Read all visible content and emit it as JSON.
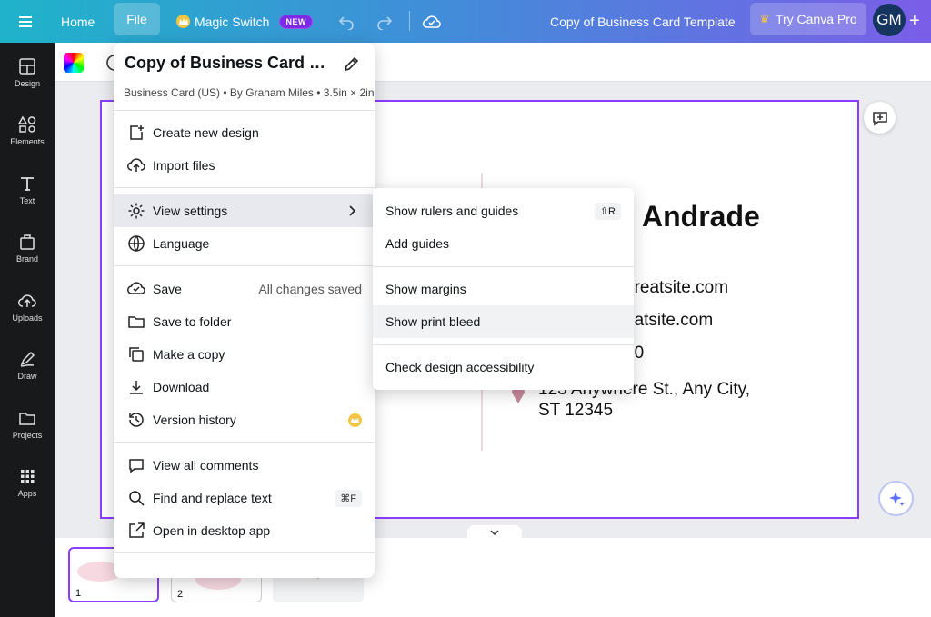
{
  "topbar": {
    "home": "Home",
    "file": "File",
    "magic_switch": "Magic Switch",
    "new_badge": "NEW",
    "doc_title": "Copy of Business Card Template",
    "try_pro": "Try Canva Pro",
    "avatar_initials": "GM",
    "plus": "+"
  },
  "sidebar": {
    "items": [
      {
        "label": "Design",
        "icon": "design-icon"
      },
      {
        "label": "Elements",
        "icon": "elements-icon"
      },
      {
        "label": "Text",
        "icon": "text-icon"
      },
      {
        "label": "Brand",
        "icon": "brand-icon"
      },
      {
        "label": "Uploads",
        "icon": "uploads-icon"
      },
      {
        "label": "Draw",
        "icon": "draw-icon"
      },
      {
        "label": "Projects",
        "icon": "projects-icon"
      },
      {
        "label": "Apps",
        "icon": "apps-icon"
      }
    ]
  },
  "canvas": {
    "name_fragment": "Andrade",
    "email_fragment": "greatsite.com",
    "web_fragment": "eatsite.com",
    "phone_fragment": "90",
    "address": "123 Anywhere St., Any City, ST 12345"
  },
  "file_menu": {
    "title": "Copy of Business Card Temp...",
    "subtitle": "Business Card (US) • By Graham Miles • 3.5in × 2in",
    "items": {
      "create_new": "Create new design",
      "import": "Import files",
      "view_settings": "View settings",
      "language": "Language",
      "save": "Save",
      "save_status": "All changes saved",
      "save_to_folder": "Save to folder",
      "make_copy": "Make a copy",
      "download": "Download",
      "version_history": "Version history",
      "view_comments": "View all comments",
      "find_replace": "Find and replace text",
      "find_replace_kbd": "⌘F",
      "open_desktop": "Open in desktop app"
    }
  },
  "view_submenu": {
    "rulers": "Show rulers and guides",
    "rulers_kbd": "⇧R",
    "add_guides": "Add guides",
    "margins": "Show margins",
    "print_bleed": "Show print bleed",
    "accessibility": "Check design accessibility"
  },
  "pages": {
    "page1": "1",
    "page2": "2",
    "add": "+"
  },
  "colors": {
    "accent": "#8b3dff",
    "topbar_start": "#1fb3c9",
    "topbar_end": "#7a5ee8",
    "sidebar": "#18191b"
  }
}
